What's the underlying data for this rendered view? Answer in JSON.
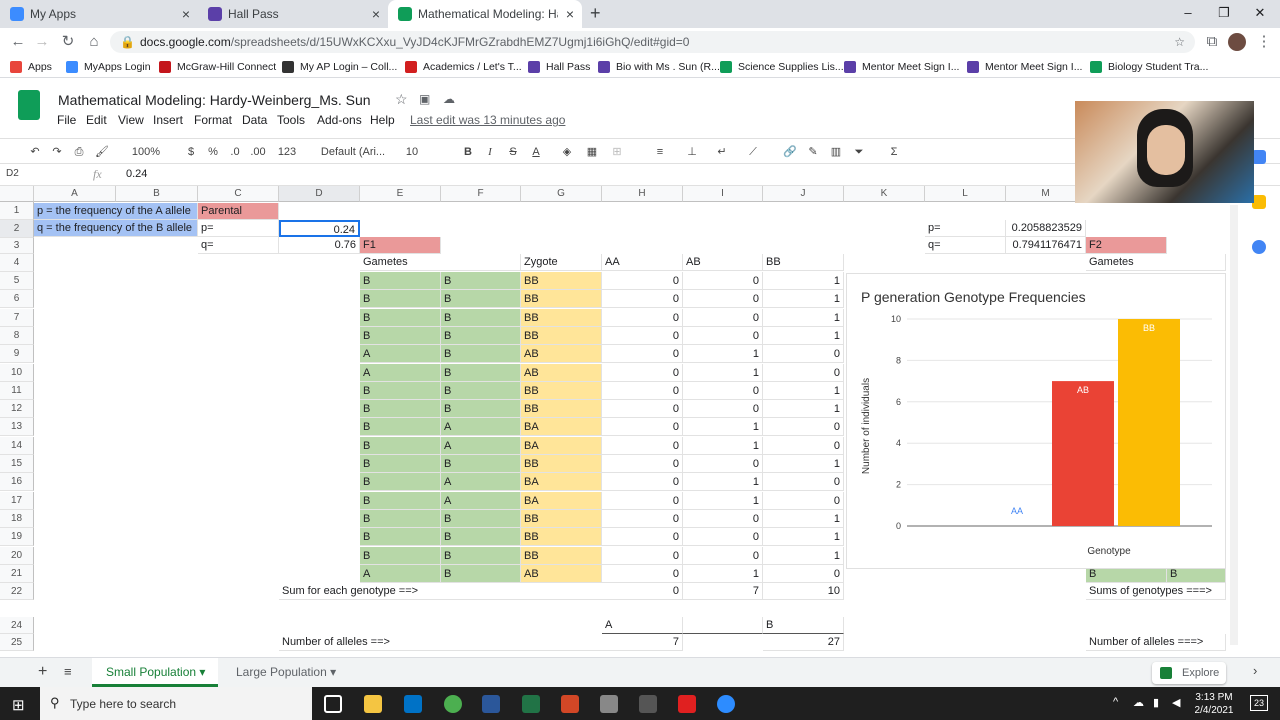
{
  "browser": {
    "tabs": [
      {
        "label": "My Apps",
        "color": "#3c8cff"
      },
      {
        "label": "Hall Pass",
        "color": "#5b3fa8"
      },
      {
        "label": "Mathematical Modeling: Hardy-W",
        "color": "#0f9d58"
      }
    ],
    "url_host": "docs.google.com",
    "url_path": "/spreadsheets/d/15UWxKCXxu_VyJD4cKJFMrGZrabdhEMZ7Ugmj1i6iGhQ/edit#gid=0",
    "bookmarks": [
      {
        "label": "Apps",
        "color": "#e8453c"
      },
      {
        "label": "MyApps Login",
        "color": "#3c8cff"
      },
      {
        "label": "McGraw-Hill Connect",
        "color": "#c4161c"
      },
      {
        "label": "My AP Login – Coll...",
        "color": "#333333"
      },
      {
        "label": "Academics / Let's T...",
        "color": "#d21f1f"
      },
      {
        "label": "Hall Pass",
        "color": "#5b3fa8"
      },
      {
        "label": "Bio with Ms . Sun (R...",
        "color": "#5b3fa8"
      },
      {
        "label": "Science Supplies Lis...",
        "color": "#0f9d58"
      },
      {
        "label": "Mentor Meet Sign I...",
        "color": "#5b3fa8"
      },
      {
        "label": "Mentor Meet Sign I...",
        "color": "#5b3fa8"
      },
      {
        "label": "Biology Student Tra...",
        "color": "#0f9d58"
      }
    ]
  },
  "doc": {
    "title": "Mathematical Modeling: Hardy-Weinberg_Ms. Sun",
    "last_edit": "Last edit was 13 minutes ago",
    "menus": [
      "File",
      "Edit",
      "View",
      "Insert",
      "Format",
      "Data",
      "Tools",
      "Add-ons",
      "Help"
    ]
  },
  "format_bar": {
    "zoom": "100%",
    "currency": "$",
    "percent": "%",
    "dec_less": ".0",
    "dec_more": ".00",
    "numfmt": "123",
    "font": "Default (Ari...",
    "font_size": "10"
  },
  "formula_bar": {
    "cell_ref": "D2",
    "fx": "fx",
    "value": "0.24"
  },
  "columns": [
    "A",
    "B",
    "C",
    "D",
    "E",
    "F",
    "G",
    "H",
    "I",
    "J",
    "K",
    "L",
    "M"
  ],
  "rows": [
    1,
    2,
    3,
    4,
    5,
    6,
    7,
    8,
    9,
    10,
    11,
    12,
    13,
    14,
    15,
    16,
    17,
    18,
    19,
    20,
    21,
    22,
    24,
    25
  ],
  "labels": {
    "a1": "p = the frequency of the A allele",
    "a2": "q = the frequency of the B allele",
    "c1": "Parental",
    "c2": "p=",
    "c3": "q=",
    "d2": "0.24",
    "d3": "0.76",
    "e3": "F1",
    "e4": "Gametes",
    "g4": "Zygote",
    "h4": "AA",
    "i4": "AB",
    "j4": "BB",
    "l2": "p=",
    "l3": "q=",
    "m2": "0.2058823529",
    "m3": "0.7941176471",
    "n3": "F2",
    "n4": "Gametes",
    "d22": "Sum for each genotype ==>",
    "h22": "0",
    "i22": "7",
    "j22": "10",
    "n22": "Sums of genotypes ===>",
    "h24": "A",
    "j24": "B",
    "d25": "Number of alleles ==>",
    "h25": "7",
    "j25": "27",
    "n25": "Number of alleles ===>",
    "n21a": "B",
    "n21b": "B"
  },
  "table": [
    [
      "B",
      "B",
      "BB",
      "0",
      "0",
      "1"
    ],
    [
      "B",
      "B",
      "BB",
      "0",
      "0",
      "1"
    ],
    [
      "B",
      "B",
      "BB",
      "0",
      "0",
      "1"
    ],
    [
      "B",
      "B",
      "BB",
      "0",
      "0",
      "1"
    ],
    [
      "A",
      "B",
      "AB",
      "0",
      "1",
      "0"
    ],
    [
      "A",
      "B",
      "AB",
      "0",
      "1",
      "0"
    ],
    [
      "B",
      "B",
      "BB",
      "0",
      "0",
      "1"
    ],
    [
      "B",
      "B",
      "BB",
      "0",
      "0",
      "1"
    ],
    [
      "B",
      "A",
      "BA",
      "0",
      "1",
      "0"
    ],
    [
      "B",
      "A",
      "BA",
      "0",
      "1",
      "0"
    ],
    [
      "B",
      "B",
      "BB",
      "0",
      "0",
      "1"
    ],
    [
      "B",
      "A",
      "BA",
      "0",
      "1",
      "0"
    ],
    [
      "B",
      "A",
      "BA",
      "0",
      "1",
      "0"
    ],
    [
      "B",
      "B",
      "BB",
      "0",
      "0",
      "1"
    ],
    [
      "B",
      "B",
      "BB",
      "0",
      "0",
      "1"
    ],
    [
      "B",
      "B",
      "BB",
      "0",
      "0",
      "1"
    ],
    [
      "A",
      "B",
      "AB",
      "0",
      "1",
      "0"
    ]
  ],
  "chart_data": {
    "type": "bar",
    "title": "P generation Genotype Frequencies",
    "xlabel": "Genotype",
    "ylabel": "Number of individuals",
    "categories": [
      "AA",
      "AB",
      "BB"
    ],
    "values": [
      0,
      7,
      10
    ],
    "colors": [
      "#4285f4",
      "#ea4335",
      "#fbbc04"
    ],
    "ylim": [
      0,
      10
    ],
    "yticks": [
      "0",
      "2",
      "4",
      "6",
      "8",
      "10"
    ]
  },
  "sheets": [
    "Small Population",
    "Large Population"
  ],
  "explore": "Explore",
  "taskbar": {
    "search": "Type here to search",
    "time": "3:13 PM",
    "date": "2/4/2021",
    "notif": "23"
  }
}
